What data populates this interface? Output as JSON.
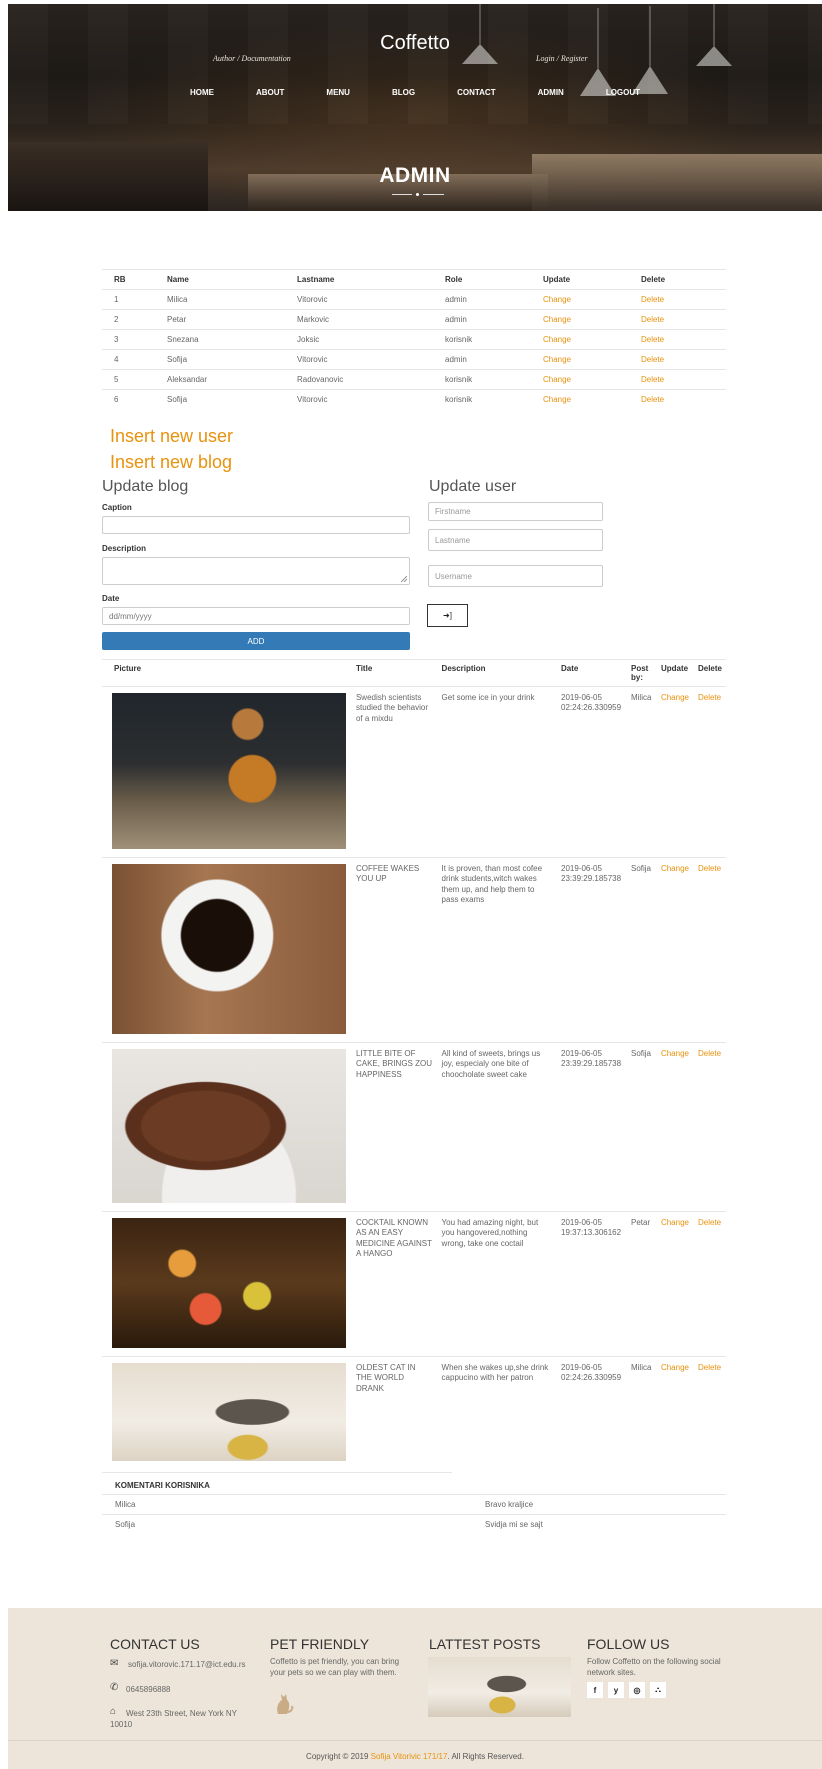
{
  "site": {
    "title": "Coffetto"
  },
  "header": {
    "left_link": "Author / Documentation",
    "right_link": "Login / Register",
    "nav": [
      "HOME",
      "ABOUT",
      "MENU",
      "BLOG",
      "CONTACT",
      "ADMIN",
      "LOGOUT"
    ],
    "page_heading": "ADMIN"
  },
  "users": {
    "headers": [
      "RB",
      "Name",
      "Lastname",
      "Role",
      "Update",
      "Delete"
    ],
    "rows": [
      {
        "rb": "1",
        "name": "Milica",
        "lastname": "Vitorovic",
        "role": "admin",
        "update": "Change",
        "delete": "Delete"
      },
      {
        "rb": "2",
        "name": "Petar",
        "lastname": "Markovic",
        "role": "admin",
        "update": "Change",
        "delete": "Delete"
      },
      {
        "rb": "3",
        "name": "Snezana",
        "lastname": "Joksic",
        "role": "korisnik",
        "update": "Change",
        "delete": "Delete"
      },
      {
        "rb": "4",
        "name": "Sofija",
        "lastname": "Vitorovic",
        "role": "admin",
        "update": "Change",
        "delete": "Delete"
      },
      {
        "rb": "5",
        "name": "Aleksandar",
        "lastname": "Radovanovic",
        "role": "korisnik",
        "update": "Change",
        "delete": "Delete"
      },
      {
        "rb": "6",
        "name": "Sofija",
        "lastname": "Vitorovic",
        "role": "korisnik",
        "update": "Change",
        "delete": "Delete"
      }
    ]
  },
  "links": {
    "insert_user": "Insert new user",
    "insert_blog": "Insert new blog"
  },
  "update_blog": {
    "title": "Update blog",
    "caption_label": "Caption",
    "description_label": "Description",
    "date_label": "Date",
    "date_placeholder": "dd/mm/yyyy",
    "add_label": "ADD"
  },
  "update_user": {
    "title": "Update user",
    "firstname_placeholder": "Firstname",
    "lastname_placeholder": "Lastname",
    "username_placeholder": "Username",
    "submit_icon": "➜]"
  },
  "blogs": {
    "headers": [
      "Picture",
      "Title",
      "Description",
      "Date",
      "Post by:",
      "Update",
      "Delete"
    ],
    "rows": [
      {
        "picture": "whiskey-glass-image",
        "title": "Swedish scientists studied the behavior of a mixdu",
        "description": "Get some ice in your drink",
        "date": "2019-06-05 02:24:26.330959",
        "post_by": "Milica",
        "update": "Change",
        "delete": "Delete"
      },
      {
        "picture": "coffee-cup-image",
        "title": "COFFEE WAKES YOU UP",
        "description": "It is proven, than most cofee drink students,witch wakes them up, and help them to pass exams",
        "date": "2019-06-05 23:39:29.185738",
        "post_by": "Sofija",
        "update": "Change",
        "delete": "Delete"
      },
      {
        "picture": "chocolate-cake-image",
        "title": "LITTLE BITE OF CAKE, BRINGS ZOU HAPPINESS",
        "description": "All kind of sweets, brings us joy, especialy one bite of choocholate sweet cake",
        "date": "2019-06-05 23:39:29.185738",
        "post_by": "Sofija",
        "update": "Change",
        "delete": "Delete"
      },
      {
        "picture": "cocktails-image",
        "title": "COCKTAIL KNOWN AS AN EASY MEDICINE AGAINST A HANGO",
        "description": "You had amazing night, but you hangovered,nothing wrong, take one coctail",
        "date": "2019-06-05 19:37:13.306162",
        "post_by": "Petar",
        "update": "Change",
        "delete": "Delete"
      },
      {
        "picture": "cat-cappuccino-image",
        "title": "OLDEST CAT IN THE WORLD DRANK",
        "description": "When she wakes up,she drink cappucino with her patron",
        "date": "2019-06-05 02:24:26.330959",
        "post_by": "Milica",
        "update": "Change",
        "delete": "Delete"
      }
    ]
  },
  "comments": {
    "heading": "KOMENTARI KORISNIKA",
    "rows": [
      {
        "user": "Milica",
        "text": "Bravo kraljice"
      },
      {
        "user": "Sofija",
        "text": "Svidja mi se sajt"
      }
    ]
  },
  "footer": {
    "contact": {
      "title": "CONTACT US",
      "email": "sofija.vitorovic.171.17@ict.edu.rs",
      "phone": "0645896888",
      "address": "West 23th Street, New York NY 10010"
    },
    "pet": {
      "title": "PET FRIENDLY",
      "text": "Coffetto is pet friendly, you can bring your pets so we can play with them."
    },
    "posts": {
      "title": "LATTEST POSTS"
    },
    "follow": {
      "title": "FOLLOW US",
      "text": "Follow Coffetto on the following social network sites.",
      "icons": [
        "f",
        "y",
        "◎",
        "⛬"
      ]
    },
    "copyright_pre": "Copyright © 2019",
    "copyright_name": "Sofija Vitorivic 171/17",
    "copyright_post": ". All Rights Reserved."
  },
  "colors": {
    "accent": "#e8920e",
    "button": "#337ab7",
    "footer_bg": "#ede5d9"
  }
}
